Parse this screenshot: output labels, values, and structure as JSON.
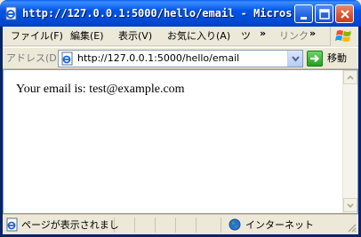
{
  "window": {
    "title": "http://127.0.0.1:5000/hello/email - Micros...",
    "buttons": {
      "minimize": "minimize",
      "maximize": "maximize",
      "close": "close"
    }
  },
  "menu": {
    "items": [
      "ファイル(F)",
      "編集(E)",
      "表示(V)",
      "お気に入り(A)",
      "ツ"
    ],
    "overflow": "»",
    "links_label": "リンク",
    "links_overflow": "»"
  },
  "address": {
    "label": "アドレス(D)",
    "url": "http://127.0.0.1:5000/hello/email",
    "go_label": "移動"
  },
  "content": {
    "text": "Your email is: test@example.com"
  },
  "status": {
    "message": "ページが表示されまし",
    "zone": "インターネット"
  },
  "colors": {
    "titlebar": "#0054e3",
    "close_button": "#d9542d",
    "chrome": "#ece9d8",
    "go_button": "#23a11e"
  },
  "icons": {
    "app": "ie-page-icon",
    "page": "ie-page-icon",
    "go": "green-arrow-icon",
    "windows": "windows-logo-icon",
    "zone": "globe-icon"
  }
}
